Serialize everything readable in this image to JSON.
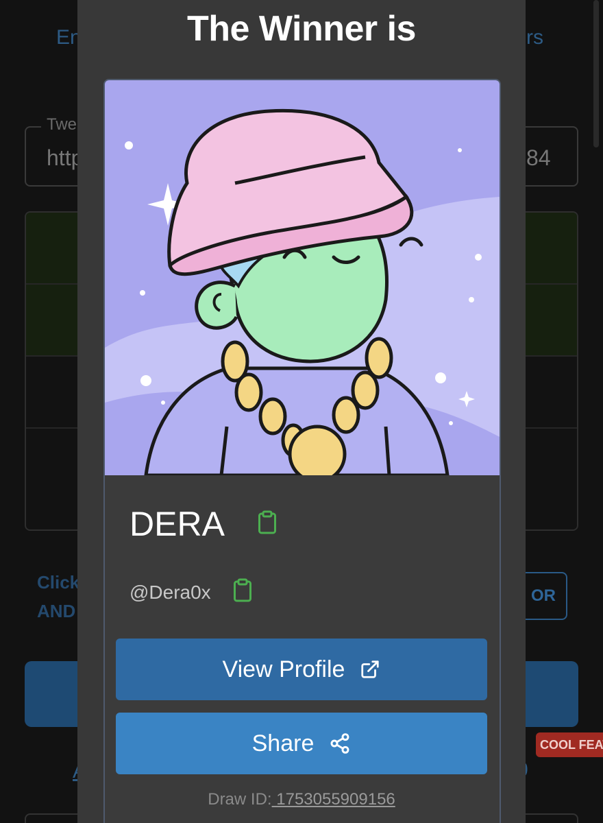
{
  "background": {
    "tab_left": "En",
    "tab_right": "rs",
    "field_label": "Twe",
    "field_value_left": "http",
    "field_value_right": "84",
    "instruction_line1": "Click",
    "instruction_line2": "AND",
    "or_button": "OR",
    "cool_features_badge": "COOL FEAT",
    "link_left": "A",
    "link_right": "0"
  },
  "modal": {
    "title": "The Winner is",
    "winner": {
      "name": "DERA",
      "handle": "@Dera0x"
    },
    "view_profile_label": "View Profile",
    "share_label": "Share",
    "draw_id_label": "Draw ID:",
    "draw_id_value": " 1753055909156"
  },
  "icons": {
    "copy_name": "clipboard-icon",
    "copy_handle": "clipboard-icon",
    "view_profile": "external-link-icon",
    "share": "share-icon"
  },
  "colors": {
    "modal_bg": "#383838",
    "primary_button": "#2f6aa3",
    "share_button": "#3a84c4",
    "clipboard_green": "#4caf50",
    "badge_red": "#a02a22"
  }
}
